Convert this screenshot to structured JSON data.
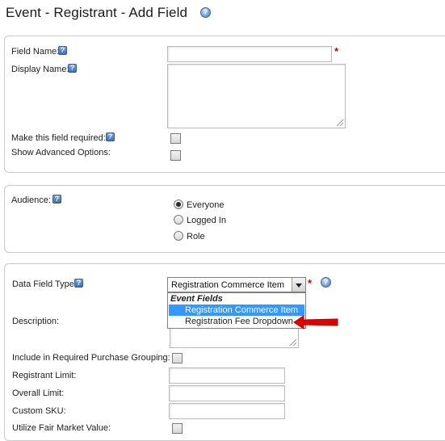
{
  "page": {
    "title": "Event - Registrant - Add Field"
  },
  "colors": {
    "required": "#c00000",
    "selection": "#3399ff",
    "arrow": "#e00000"
  },
  "icons": {
    "help": "question-mark-square-icon",
    "help_round": "question-mark-circle-icon"
  },
  "section1": {
    "field_name_label": "Field Name:",
    "field_name_value": "",
    "display_name_label": "Display Name:",
    "display_name_value": "",
    "required_label": "Make this field required:",
    "required_checked": false,
    "advanced_label": "Show Advanced Options:",
    "advanced_checked": false,
    "required_marker": "*"
  },
  "section2": {
    "audience_label": "Audience:",
    "options": [
      "Everyone",
      "Logged In",
      "Role"
    ],
    "selected": "Everyone"
  },
  "section3": {
    "data_field_type_label": "Data Field Type:",
    "selected_value": "Registration Commerce Item",
    "required_marker": "*",
    "dropdown": {
      "group_label": "Event Fields",
      "items": [
        "Registration Commerce Item",
        "Registration Fee Dropdown"
      ],
      "highlighted": "Registration Commerce Item"
    },
    "description_label": "Description:",
    "grouping_label": "Include in Required Purchase Grouping:",
    "registrant_limit_label": "Registrant Limit:",
    "overall_limit_label": "Overall Limit:",
    "custom_sku_label": "Custom SKU:",
    "fair_market_label": "Utilize Fair Market Value:"
  }
}
